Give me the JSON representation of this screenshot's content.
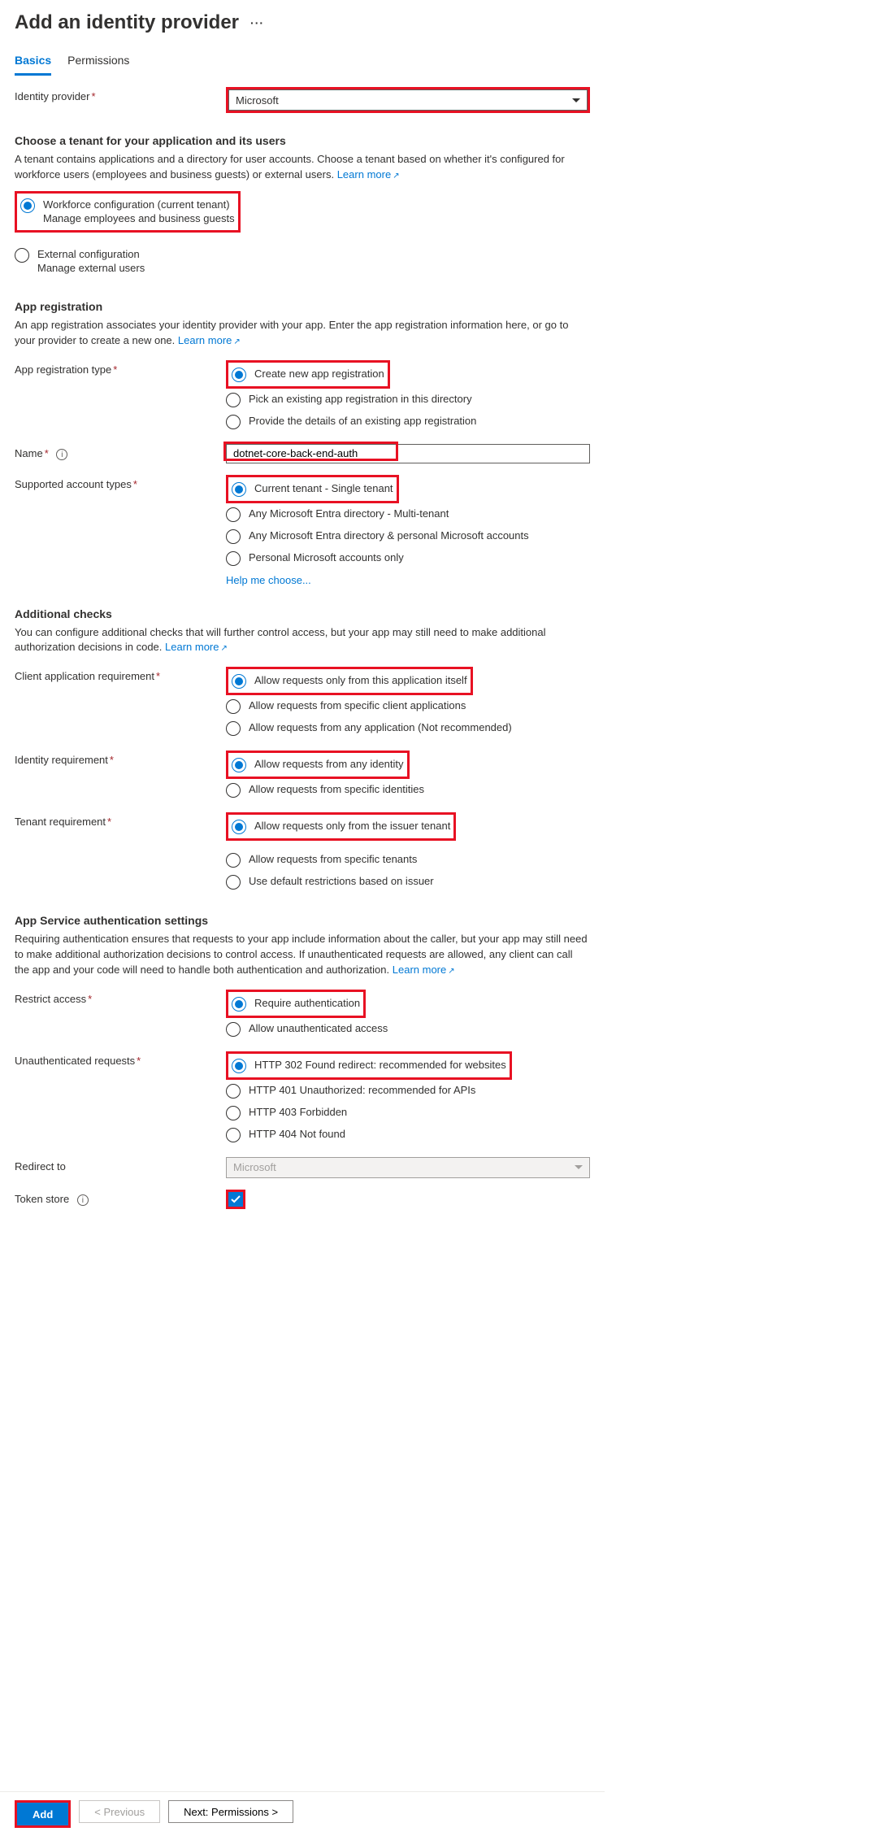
{
  "header": {
    "title": "Add an identity provider"
  },
  "tabs": {
    "basics": "Basics",
    "permissions": "Permissions"
  },
  "identity_provider": {
    "label": "Identity provider",
    "value": "Microsoft"
  },
  "tenant_section": {
    "title": "Choose a tenant for your application and its users",
    "desc": "A tenant contains applications and a directory for user accounts. Choose a tenant based on whether it's configured for workforce users (employees and business guests) or external users.",
    "learn_more": "Learn more",
    "workforce": {
      "label": "Workforce configuration (current tenant)",
      "sub": "Manage employees and business guests"
    },
    "external": {
      "label": "External configuration",
      "sub": "Manage external users"
    }
  },
  "app_reg": {
    "title": "App registration",
    "desc": "An app registration associates your identity provider with your app. Enter the app registration information here, or go to your provider to create a new one.",
    "learn_more": "Learn more",
    "type_label": "App registration type",
    "opt_new": "Create new app registration",
    "opt_pick": "Pick an existing app registration in this directory",
    "opt_details": "Provide the details of an existing app registration",
    "name_label": "Name",
    "name_value": "dotnet-core-back-end-auth",
    "acct_label": "Supported account types",
    "acct_single": "Current tenant - Single tenant",
    "acct_multi": "Any Microsoft Entra directory - Multi-tenant",
    "acct_personal": "Any Microsoft Entra directory & personal Microsoft accounts",
    "acct_msonly": "Personal Microsoft accounts only",
    "help_link": "Help me choose..."
  },
  "checks": {
    "title": "Additional checks",
    "desc": "You can configure additional checks that will further control access, but your app may still need to make additional authorization decisions in code.",
    "learn_more": "Learn more",
    "client_label": "Client application requirement",
    "client_self": "Allow requests only from this application itself",
    "client_specific": "Allow requests from specific client applications",
    "client_any": "Allow requests from any application (Not recommended)",
    "identity_label": "Identity requirement",
    "identity_any": "Allow requests from any identity",
    "identity_specific": "Allow requests from specific identities",
    "tenant_label": "Tenant requirement",
    "tenant_issuer": "Allow requests only from the issuer tenant",
    "tenant_specific": "Allow requests from specific tenants",
    "tenant_default": "Use default restrictions based on issuer"
  },
  "auth": {
    "title": "App Service authentication settings",
    "desc": "Requiring authentication ensures that requests to your app include information about the caller, but your app may still need to make additional authorization decisions to control access. If unauthenticated requests are allowed, any client can call the app and your code will need to handle both authentication and authorization.",
    "learn_more": "Learn more",
    "restrict_label": "Restrict access",
    "restrict_req": "Require authentication",
    "restrict_allow": "Allow unauthenticated access",
    "unauth_label": "Unauthenticated requests",
    "u302": "HTTP 302 Found redirect: recommended for websites",
    "u401": "HTTP 401 Unauthorized: recommended for APIs",
    "u403": "HTTP 403 Forbidden",
    "u404": "HTTP 404 Not found",
    "redirect_label": "Redirect to",
    "redirect_value": "Microsoft",
    "token_label": "Token store"
  },
  "footer": {
    "add": "Add",
    "prev": "< Previous",
    "next": "Next: Permissions >"
  }
}
